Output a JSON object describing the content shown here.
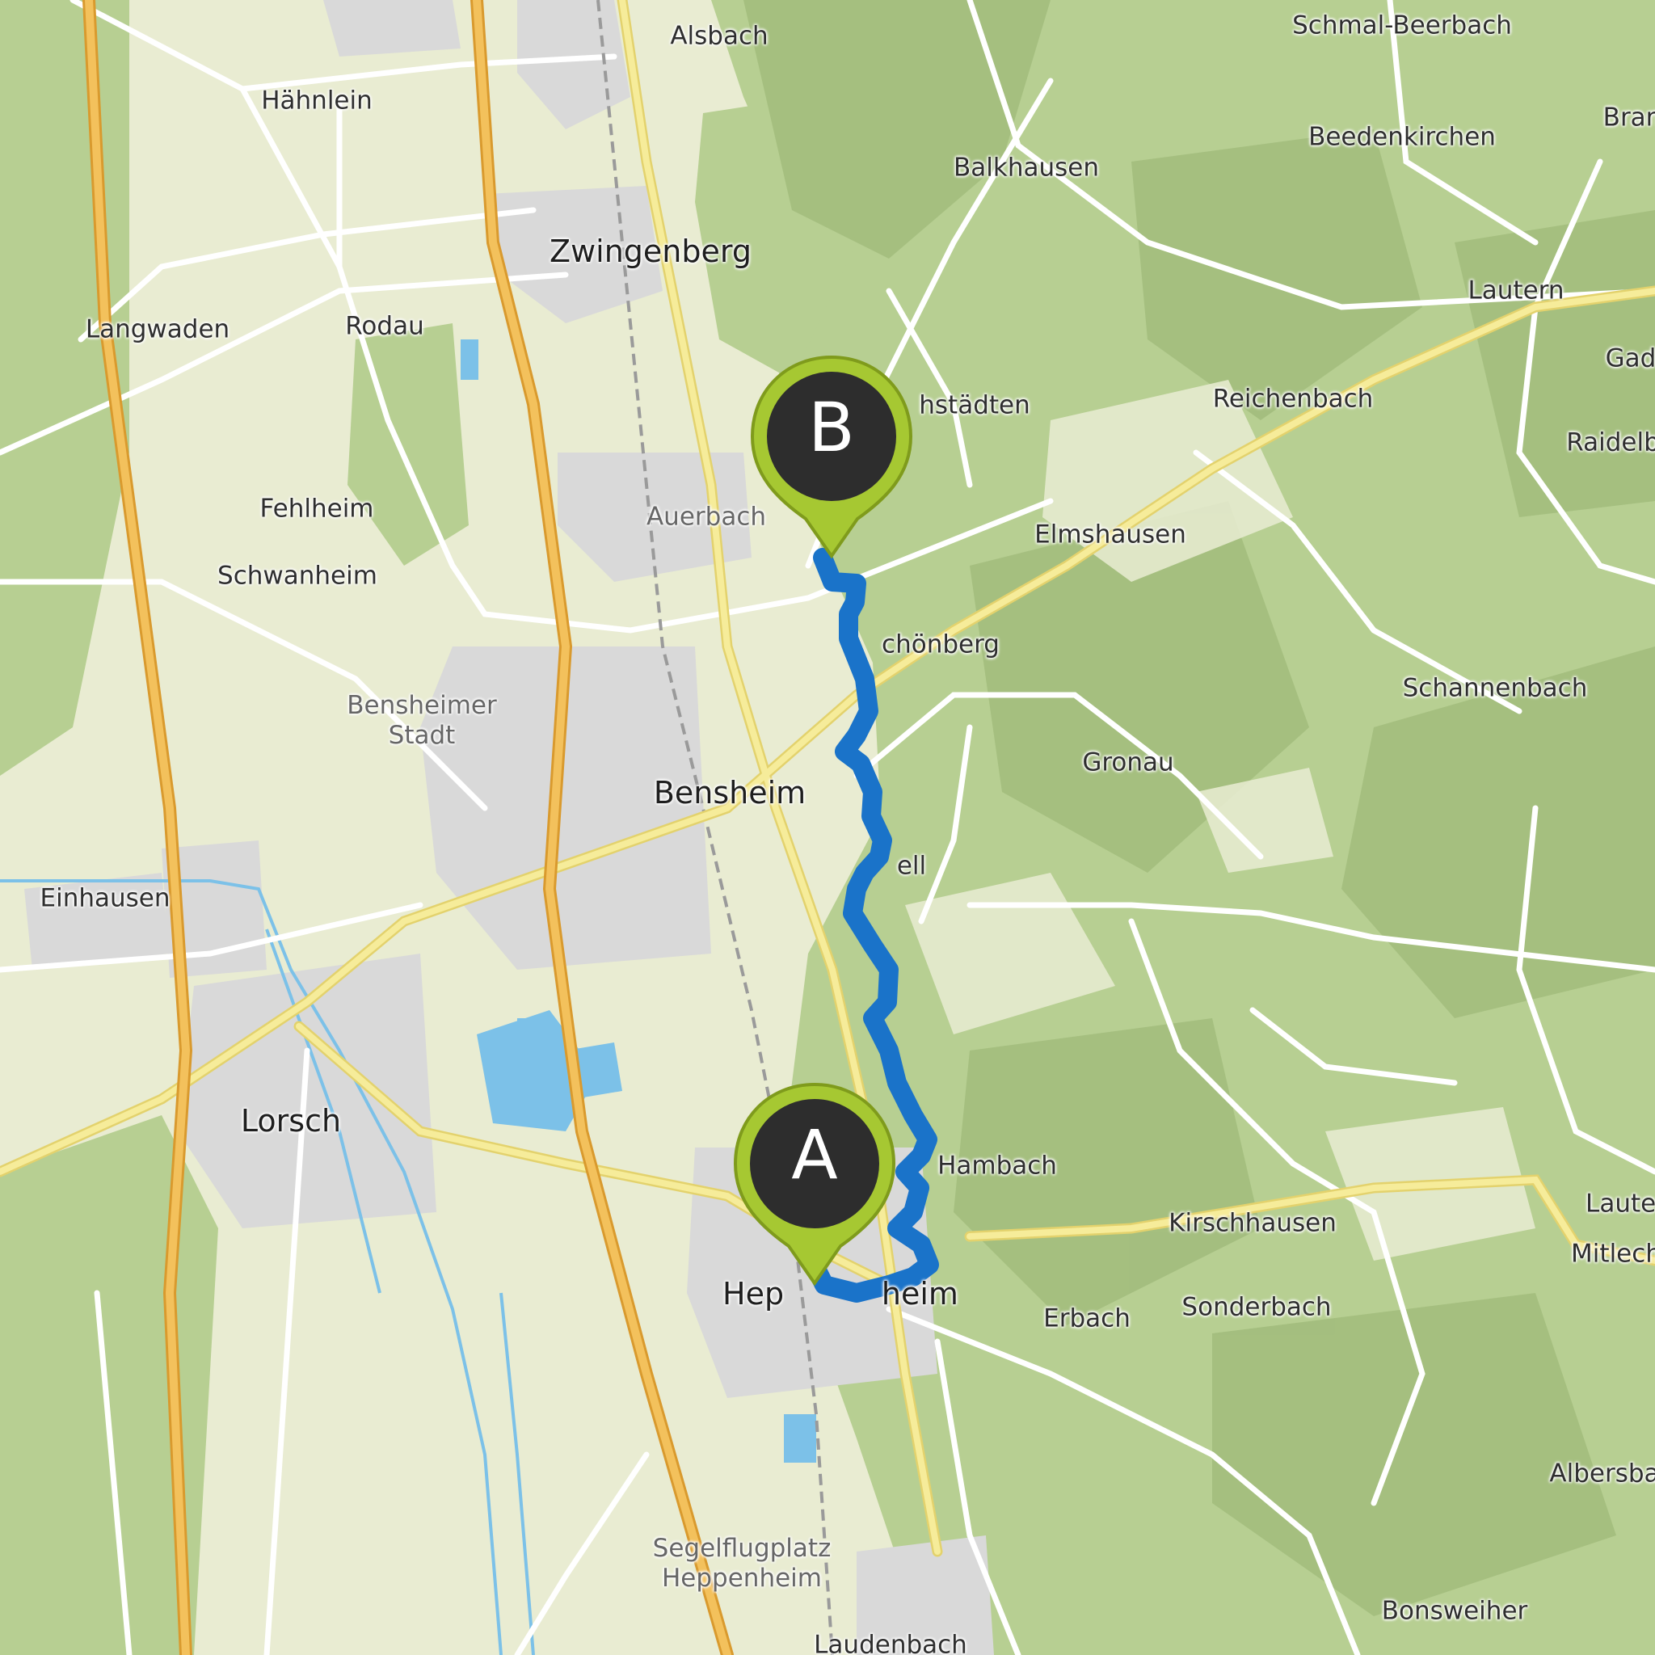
{
  "map": {
    "colors": {
      "land": "#e9ecd2",
      "forest": "#b7cf92",
      "hill_shade": "#8fa96b",
      "town": "#d8d8d8",
      "motorway": "#f0b74a",
      "primary_road": "#f3e27f",
      "road": "#ffffff",
      "water": "#7cc1e8",
      "route": "#1a73c9",
      "marker": "#a6c832",
      "marker_inner": "#2d2d2d"
    },
    "markers": [
      {
        "id": "A",
        "label": "A",
        "role": "start"
      },
      {
        "id": "B",
        "label": "B",
        "role": "end"
      }
    ],
    "places": [
      {
        "key": "alsbach",
        "name": "Alsbach"
      },
      {
        "key": "schmal_beerbach",
        "name": "Schmal-Beerbach"
      },
      {
        "key": "haehnlein",
        "name": "Hähnlein"
      },
      {
        "key": "beedenkirchen",
        "name": "Beedenkirchen"
      },
      {
        "key": "bran",
        "name": "Bran"
      },
      {
        "key": "balkhausen",
        "name": "Balkhausen"
      },
      {
        "key": "zwingenberg",
        "name": "Zwingenberg"
      },
      {
        "key": "langwaden",
        "name": "Langwaden"
      },
      {
        "key": "rodau",
        "name": "Rodau"
      },
      {
        "key": "lautern_top",
        "name": "Lautern"
      },
      {
        "key": "gad",
        "name": "Gad"
      },
      {
        "key": "hochstaedten",
        "name": "hstädten"
      },
      {
        "key": "reichenbach",
        "name": "Reichenbach"
      },
      {
        "key": "raidelb",
        "name": "Raidelb"
      },
      {
        "key": "fehlheim",
        "name": "Fehlheim"
      },
      {
        "key": "auerbach",
        "name": "Auerbach"
      },
      {
        "key": "elmshausen",
        "name": "Elmshausen"
      },
      {
        "key": "schwanheim",
        "name": "Schwanheim"
      },
      {
        "key": "schoenberg",
        "name": "chönberg"
      },
      {
        "key": "schannenbach",
        "name": "Schannenbach"
      },
      {
        "key": "bensheimer_stadt",
        "name": "Bensheimer\nStadt"
      },
      {
        "key": "gronau",
        "name": "Gronau"
      },
      {
        "key": "bensheim",
        "name": "Bensheim"
      },
      {
        "key": "zell",
        "name": "ell"
      },
      {
        "key": "einhausen",
        "name": "Einhausen"
      },
      {
        "key": "lorsch",
        "name": "Lorsch"
      },
      {
        "key": "hambach",
        "name": "Hambach"
      },
      {
        "key": "lauter_right",
        "name": "Lauter"
      },
      {
        "key": "kirschhausen",
        "name": "Kirschhausen"
      },
      {
        "key": "mitlech",
        "name": "Mitlech"
      },
      {
        "key": "heppenheim",
        "name": "Hep          heim"
      },
      {
        "key": "erbach",
        "name": "Erbach"
      },
      {
        "key": "sonderbach",
        "name": "Sonderbach"
      },
      {
        "key": "albersbach",
        "name": "Albersbac"
      },
      {
        "key": "segelflugplatz",
        "name": "Segelflugplatz\nHeppenheim"
      },
      {
        "key": "bonsweiher",
        "name": "Bonsweiher"
      },
      {
        "key": "laudenbach",
        "name": "Laudenbach"
      }
    ]
  }
}
